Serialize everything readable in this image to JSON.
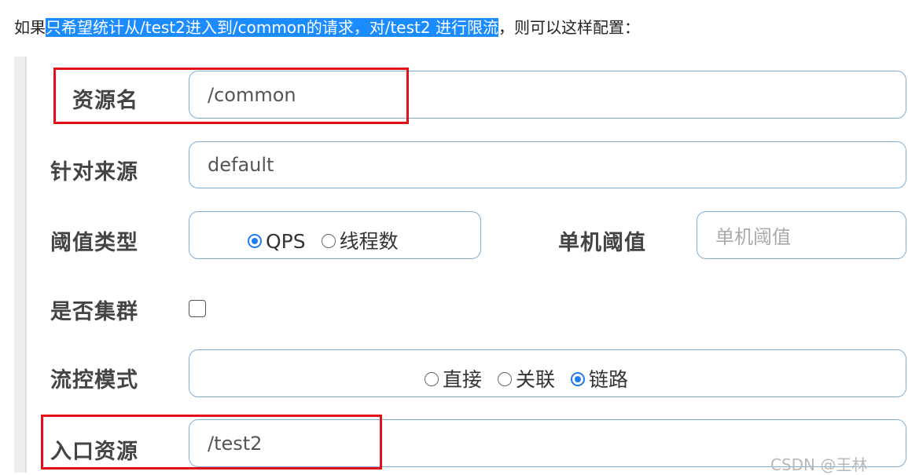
{
  "intro": {
    "prefix": "如果",
    "highlight": "只希望统计从/test2进入到/common的请求，对/test2 进行限流",
    "suffix": "，则可以这样配置："
  },
  "form": {
    "resource_name": {
      "label": "资源名",
      "value": "/common"
    },
    "limit_app": {
      "label": "针对来源",
      "value": "default"
    },
    "threshold_type": {
      "label": "阈值类型",
      "options": [
        "QPS",
        "线程数"
      ],
      "selected": "QPS"
    },
    "single_threshold": {
      "label": "单机阈值",
      "placeholder": "单机阈值"
    },
    "cluster": {
      "label": "是否集群",
      "checked": false
    },
    "flow_mode": {
      "label": "流控模式",
      "options": [
        "直接",
        "关联",
        "链路"
      ],
      "selected": "链路"
    },
    "entry_resource": {
      "label": "入口资源",
      "value": "/test2"
    }
  },
  "watermark": "CSDN @王林",
  "colors": {
    "highlight": "#1a8cff",
    "accent": "#1e7cf5",
    "annotation": "#e3101a"
  }
}
